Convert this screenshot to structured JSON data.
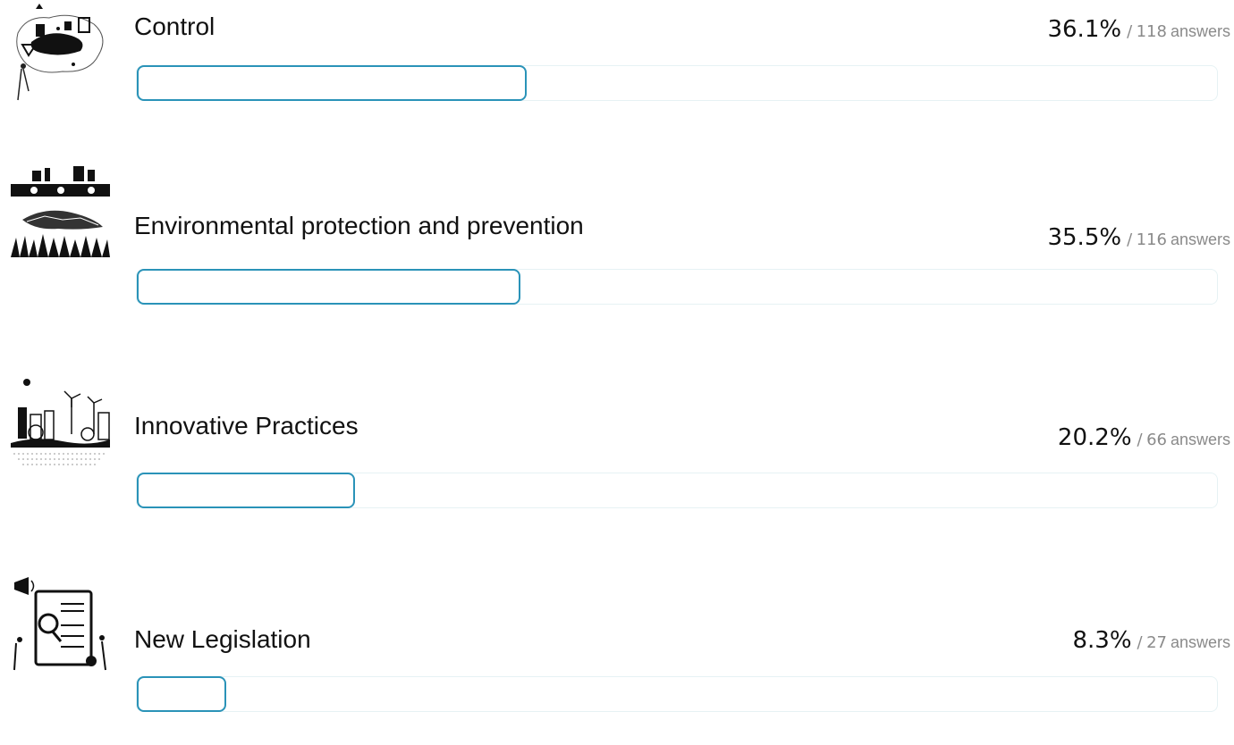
{
  "results": [
    {
      "label": "Control",
      "percent_text": "36.1%",
      "separator": "/",
      "answers": "118",
      "answers_word": "answers",
      "percent": 36.1,
      "illustration": "map-control-illustration"
    },
    {
      "label": "Environmental protection and prevention",
      "percent_text": "35.5%",
      "separator": "/",
      "answers": "116",
      "answers_word": "answers",
      "percent": 35.5,
      "illustration": "factory-ecosystem-illustration"
    },
    {
      "label": "Innovative Practices",
      "percent_text": "20.2%",
      "separator": "/",
      "answers": "66",
      "answers_word": "answers",
      "percent": 20.2,
      "illustration": "green-city-illustration"
    },
    {
      "label": "New Legislation",
      "percent_text": "8.3%",
      "separator": "/",
      "answers": "27",
      "answers_word": "answers",
      "percent": 8.3,
      "illustration": "legislation-document-illustration"
    }
  ],
  "colors": {
    "bar_border": "#2a93b8",
    "track_border": "#e6f2f4",
    "muted_text": "#8a8a8a"
  }
}
